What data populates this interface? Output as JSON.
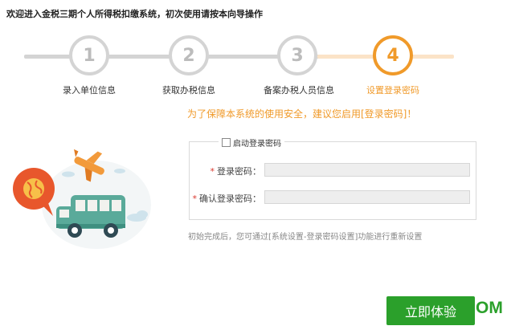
{
  "header": {
    "title": "欢迎进入金税三期个人所得税扣缴系统，初次使用请按本向导操作"
  },
  "wizard": {
    "steps": [
      {
        "number": "1",
        "label": "录入单位信息",
        "state": "done"
      },
      {
        "number": "2",
        "label": "获取办税信息",
        "state": "done"
      },
      {
        "number": "3",
        "label": "备案办税人员信息",
        "state": "done"
      },
      {
        "number": "4",
        "label": "设置登录密码",
        "state": "active"
      }
    ]
  },
  "notice": "为了保障本系统的使用安全，建议您启用[登录密码]！",
  "password_form": {
    "enable_label": "启动登录密码",
    "enabled": false,
    "required_mark": "*",
    "password_label": "登录密码：",
    "confirm_label": "确认登录密码："
  },
  "hint": "初始完成后，您可通过[系统设置-登录密码设置]功能进行重新设置",
  "actions": {
    "start_label": "立即体验"
  },
  "watermark": "OM",
  "colors": {
    "accent": "#f09a2a",
    "inactive": "#d4d4d4",
    "button": "#2ba02b"
  },
  "illustration": {
    "icons": [
      "globe-speech-bubble-icon",
      "airplane-icon",
      "bus-icon",
      "cloud-icon"
    ]
  }
}
